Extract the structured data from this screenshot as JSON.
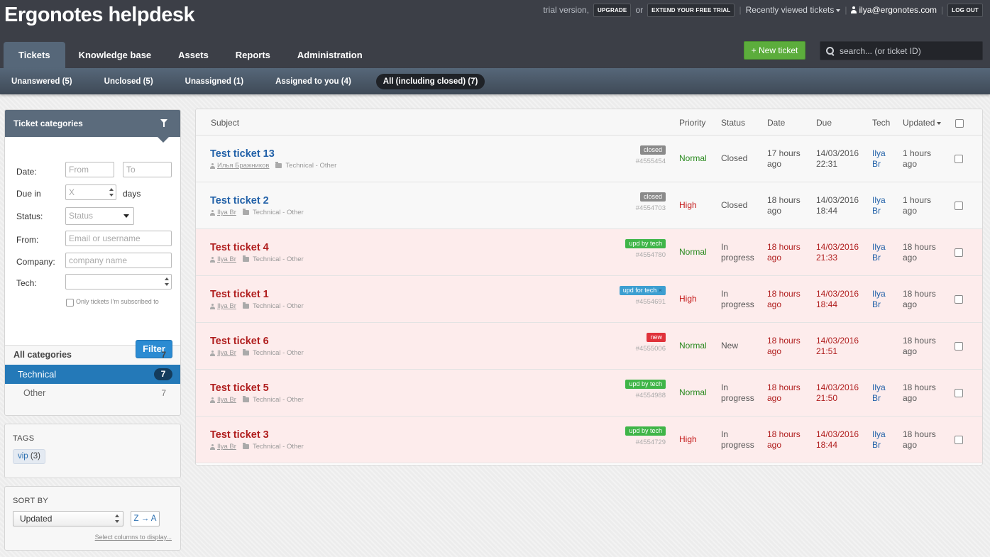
{
  "app": {
    "title": "Ergonotes helpdesk"
  },
  "topbar": {
    "trial_text": "trial version,",
    "upgrade_label": "UPGRADE",
    "or_text": "or",
    "extend_label": "EXTEND YOUR FREE TRIAL",
    "recent_label": "Recently viewed tickets",
    "user_email": "ilya@ergonotes.com",
    "logout_label": "LOG OUT"
  },
  "nav": {
    "tabs": [
      {
        "label": "Tickets"
      },
      {
        "label": "Knowledge base"
      },
      {
        "label": "Assets"
      },
      {
        "label": "Reports"
      },
      {
        "label": "Administration"
      }
    ],
    "new_ticket_label": "+ New ticket",
    "search_placeholder": "search... (or ticket ID)"
  },
  "subnav": [
    {
      "label": "Unanswered (5)"
    },
    {
      "label": "Unclosed (5)"
    },
    {
      "label": "Unassigned (1)"
    },
    {
      "label": "Assigned to you (4)"
    },
    {
      "label": "All (including closed) (7)"
    }
  ],
  "sidebar": {
    "title": "Ticket categories",
    "date_label": "Date:",
    "date_from_placeholder": "From",
    "date_to_placeholder": "To",
    "due_label": "Due in",
    "due_placeholder": "X",
    "due_unit": "days",
    "status_label": "Status:",
    "status_value": "Status",
    "from_label": "From:",
    "from_placeholder": "Email or username",
    "company_label": "Company:",
    "company_placeholder": "company name",
    "tech_label": "Tech:",
    "subscribed_label": "Only tickets I'm subscribed to",
    "filter_label": "Filter",
    "categories": [
      {
        "label": "All categories",
        "count": "7"
      },
      {
        "label": "Technical",
        "count": "7"
      },
      {
        "label": "Other",
        "count": "7"
      }
    ]
  },
  "tags": {
    "title": "TAGS",
    "items": [
      {
        "name": "vip",
        "count": "(3)"
      }
    ]
  },
  "sort": {
    "title": "SORT BY",
    "value": "Updated",
    "order_label": "Z → A",
    "select_columns_label": "Select columns to display..."
  },
  "table": {
    "headers": {
      "subject": "Subject",
      "priority": "Priority",
      "status": "Status",
      "date": "Date",
      "due": "Due",
      "tech": "Tech",
      "updated": "Updated"
    },
    "rows": [
      {
        "subject": "Test ticket 13",
        "author": "Илья Бражников",
        "category": "Technical - Other",
        "badge": "closed",
        "id": "#4555454",
        "priority": "Normal",
        "status": [
          "Closed"
        ],
        "date": [
          "17 hours",
          "ago"
        ],
        "due": [
          "14/03/2016",
          "22:31"
        ],
        "tech": [
          "Ilya",
          "Br"
        ],
        "updated": [
          "1 hours",
          "ago"
        ]
      },
      {
        "subject": "Test ticket 2",
        "author": "Ilya Br",
        "category": "Technical - Other",
        "badge": "closed",
        "id": "#4554703",
        "priority": "High",
        "status": [
          "Closed"
        ],
        "date": [
          "18 hours",
          "ago"
        ],
        "due": [
          "14/03/2016",
          "18:44"
        ],
        "tech": [
          "Ilya",
          "Br"
        ],
        "updated": [
          "1 hours",
          "ago"
        ]
      },
      {
        "subject": "Test ticket 4",
        "author": "Ilya Br",
        "category": "Technical - Other",
        "badge": "upd by tech",
        "id": "#4554780",
        "priority": "Normal",
        "status": [
          "In",
          "progress"
        ],
        "date": [
          "18 hours",
          "ago"
        ],
        "due": [
          "14/03/2016",
          "21:33"
        ],
        "tech": [
          "Ilya",
          "Br"
        ],
        "updated": [
          "18 hours",
          "ago"
        ]
      },
      {
        "subject": "Test ticket 1",
        "author": "Ilya Br",
        "category": "Technical - Other",
        "badge": "upd for tech",
        "badge_close": "×",
        "id": "#4554691",
        "priority": "High",
        "status": [
          "In",
          "progress"
        ],
        "date": [
          "18 hours",
          "ago"
        ],
        "due": [
          "14/03/2016",
          "18:44"
        ],
        "tech": [
          "Ilya",
          "Br"
        ],
        "updated": [
          "18 hours",
          "ago"
        ]
      },
      {
        "subject": "Test ticket 6",
        "author": "Ilya Br",
        "category": "Technical - Other",
        "badge": "new",
        "id": "#4555006",
        "priority": "Normal",
        "status": [
          "New"
        ],
        "date": [
          "18 hours",
          "ago"
        ],
        "due": [
          "14/03/2016",
          "21:51"
        ],
        "tech": [
          "",
          ""
        ],
        "updated": [
          "18 hours",
          "ago"
        ]
      },
      {
        "subject": "Test ticket 5",
        "author": "Ilya Br",
        "category": "Technical - Other",
        "badge": "upd by tech",
        "id": "#4554988",
        "priority": "Normal",
        "status": [
          "In",
          "progress"
        ],
        "date": [
          "18 hours",
          "ago"
        ],
        "due": [
          "14/03/2016",
          "21:50"
        ],
        "tech": [
          "Ilya",
          "Br"
        ],
        "updated": [
          "18 hours",
          "ago"
        ]
      },
      {
        "subject": "Test ticket 3",
        "author": "Ilya Br",
        "category": "Technical - Other",
        "badge": "upd by tech",
        "id": "#4554729",
        "priority": "High",
        "status": [
          "In",
          "progress"
        ],
        "date": [
          "18 hours",
          "ago"
        ],
        "due": [
          "14/03/2016",
          "18:44"
        ],
        "tech": [
          "Ilya",
          "Br"
        ],
        "updated": [
          "18 hours",
          "ago"
        ]
      }
    ]
  },
  "colors": {
    "priority_normal": "#2a8a1f",
    "priority_high": "#c41a1a",
    "overdue": "#b01e1e",
    "badge_closed": "#8a8a8a",
    "badge_upd_by_tech": "#3fb548",
    "badge_upd_for_tech": "#3d9fd1",
    "badge_new": "#e0323b"
  }
}
